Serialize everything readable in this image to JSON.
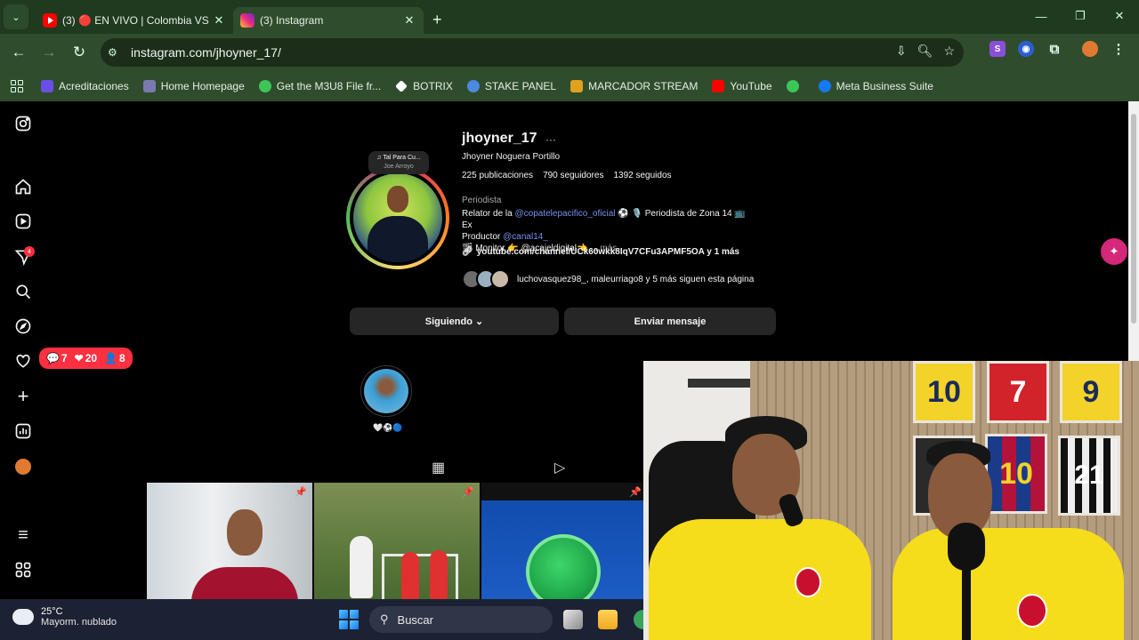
{
  "browser": {
    "tabs": [
      {
        "label": "(3) 🔴 EN VIVO | Colombia VS C",
        "icon": "youtube-icon"
      },
      {
        "label": "(3) Instagram",
        "icon": "instagram-icon"
      }
    ],
    "url": "instagram.com/jhoyner_17/",
    "bookmarks": [
      {
        "label": "Acreditaciones",
        "color": "#6b4ee6"
      },
      {
        "label": "Home Homepage",
        "color": "#7a7ab0"
      },
      {
        "label": "Get the M3U8 File fr...",
        "color": "#3cc65a"
      },
      {
        "label": "BOTRIX",
        "color": "#ffffff"
      },
      {
        "label": "STAKE PANEL",
        "color": "#4a8ae0"
      },
      {
        "label": "MARCADOR STREAM",
        "color": "#e0a020"
      },
      {
        "label": "YouTube",
        "color": "#ff0000"
      },
      {
        "label": "",
        "color": "#3cc65a"
      },
      {
        "label": "Meta Business Suite",
        "color": "#1877f2"
      }
    ]
  },
  "profile": {
    "username": "jhoyner_17",
    "full_name": "Jhoyner Noguera Portillo",
    "stats": {
      "posts": "225 publicaciones",
      "followers": "790 seguidores",
      "following": "1392 seguidos"
    },
    "category": "Periodista",
    "note": {
      "line1": "♫ Tal Para Cu...",
      "line2": "Joe Arroyo"
    },
    "bio": {
      "l1_prefix": "Relator de la ",
      "l1_mention": "@copatelepacifico_oficial",
      "l1_suffix": " ⚽ 🎙️ Periodista de Zona 14 📺 Ex",
      "l2_prefix": "Productor ",
      "l2_mention": "@canal14_",
      "l3": "🎬 Monitor 👉 @acajeldigital👈 ...",
      "l3_more": " más"
    },
    "link": "youtube.com/channel/UCk60wkk8IqV7CFu3APMF5OA y 1 más",
    "followed_by": "luchovasquez98_, maleurriago8 y 5 más siguen esta página",
    "following_button": "Siguiendo ⌄",
    "message_button": "Enviar mensaje",
    "highlight_label": "🤍⚽🔵"
  },
  "notifications": {
    "comments": "7",
    "likes": "20",
    "follows": "8",
    "badge": "4"
  },
  "cam": {
    "jerseys": [
      "10",
      "7",
      "9",
      "10",
      "21"
    ]
  },
  "taskbar": {
    "temperature": "25°C",
    "condition": "Mayorm. nublado",
    "search_placeholder": "Buscar"
  },
  "colors": {
    "accent": "#d4287a",
    "notification": "#ff3040",
    "chrome": "#2f4d2c",
    "jersey_yellow": "#f6dd1c"
  }
}
